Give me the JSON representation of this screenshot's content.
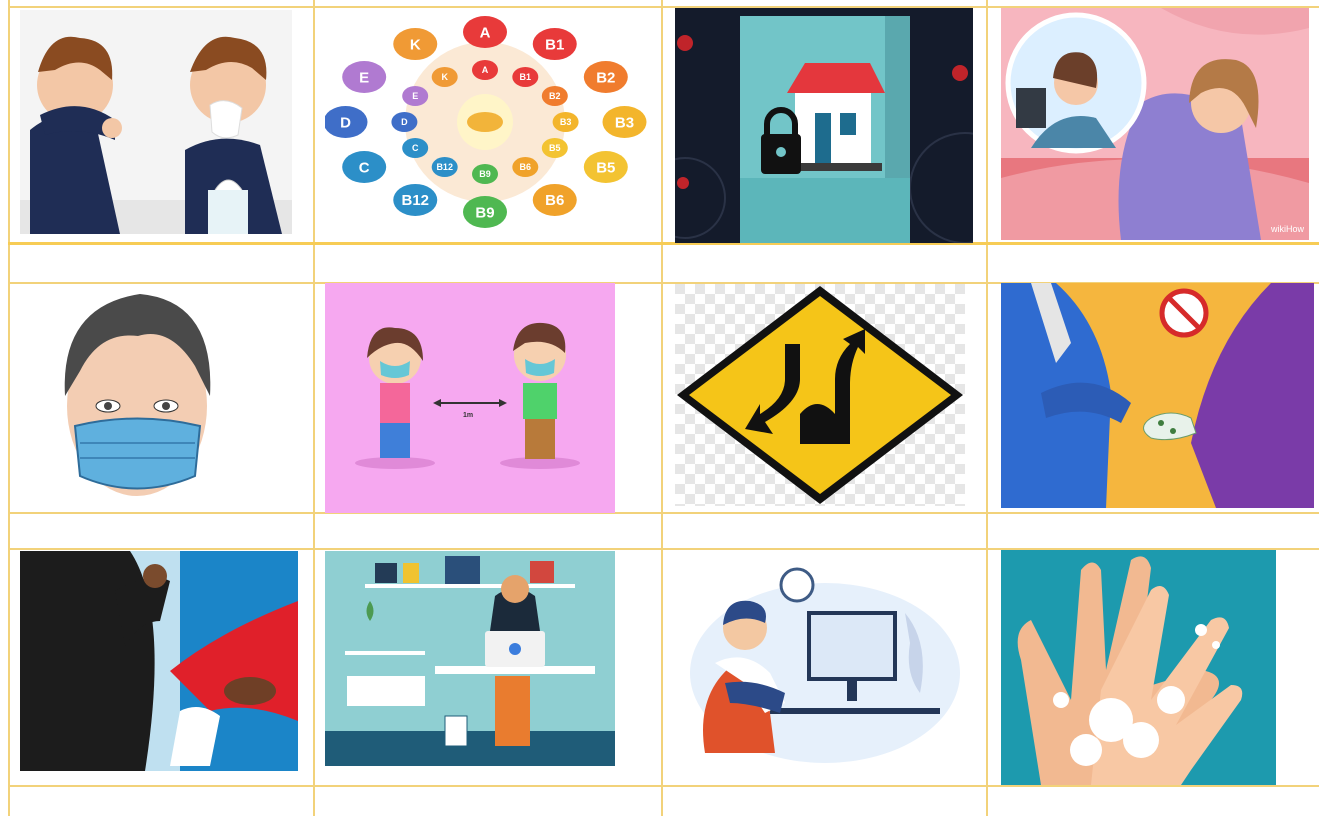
{
  "vitamins": {
    "outer": [
      "K",
      "A",
      "B1",
      "B2",
      "B3",
      "B5",
      "B6",
      "B9",
      "B12",
      "C",
      "D",
      "E"
    ],
    "inner": [
      "K",
      "A",
      "B1",
      "B2",
      "B3",
      "B5",
      "B6",
      "B9",
      "B12",
      "C",
      "D",
      "E"
    ]
  },
  "distance_label": "1m",
  "watermark": "wikiHow"
}
